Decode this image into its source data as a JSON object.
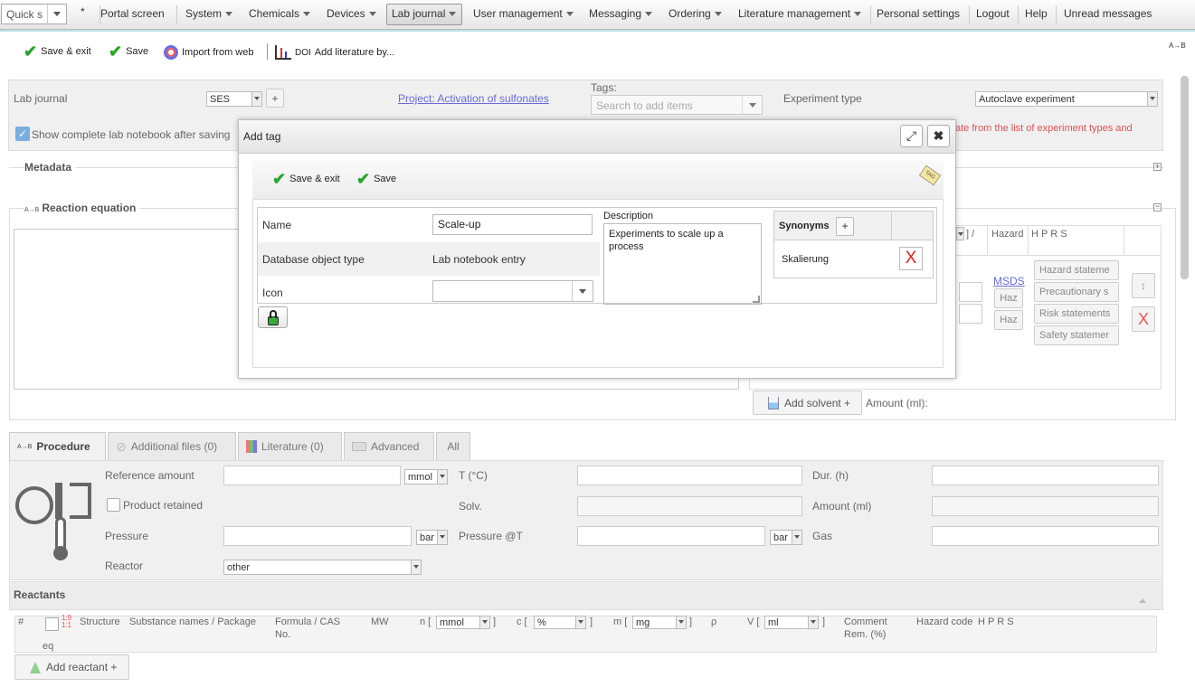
{
  "menubar": {
    "quick_search": "Quick s",
    "star": "*",
    "items": [
      "Portal screen",
      "System",
      "Chemicals",
      "Devices",
      "Lab journal",
      "User management",
      "Messaging",
      "Ordering",
      "Literature management",
      "Personal settings",
      "Logout",
      "Help",
      "Unread messages"
    ]
  },
  "toolbar": {
    "save_exit": "Save & exit",
    "save": "Save",
    "import_web": "Import from web",
    "doi": "DOI",
    "add_literature": "Add literature by...",
    "right_icon": "A→B"
  },
  "form": {
    "lab_journal_label": "Lab journal",
    "lab_journal_value": "SES",
    "plus": "+",
    "project_link": "Project: Activation of sulfonates",
    "tags_label": "Tags:",
    "tags_placeholder": "Search to add items",
    "experiment_type_label": "Experiment type",
    "experiment_type_value": "Autoclave experiment",
    "show_notebook": "Show complete lab notebook after saving",
    "warning_text": "ate from the list of experiment types and",
    "metadata_legend": "Metadata",
    "reaction_legend": "Reaction equation",
    "reaction_prefix": "A→B",
    "hazard_col": "Hazard",
    "hprs_col": "H P R S",
    "bracket_col": "] /",
    "msds": "MSDS",
    "haz": "Haz",
    "hazard_statements": "Hazard stateme",
    "precautionary": "Precautionary s",
    "risk_statements": "Risk statements",
    "safety_statements": "Safety statemer",
    "add_solvent": "Add solvent +",
    "amount_ml_label": "Amount (ml):"
  },
  "tabs": [
    {
      "label": "Procedure",
      "icon": "reaction-icon",
      "prefix": "A→B"
    },
    {
      "label": "Additional files (0)",
      "icon": "paperclip-icon"
    },
    {
      "label": "Literature (0)",
      "icon": "books-icon"
    },
    {
      "label": "Advanced",
      "icon": "advanced-icon"
    },
    {
      "label": "All"
    }
  ],
  "procedure": {
    "reference_amount": "Reference amount",
    "ref_unit": "mmol",
    "temp": "T (°C)",
    "duration": "Dur. (h)",
    "product_retained": "Product retained",
    "solv": "Solv.",
    "amount_ml": "Amount (ml)",
    "pressure": "Pressure",
    "pressure_unit": "bar",
    "pressure_t": "Pressure @T",
    "pressure_t_unit": "bar",
    "gas": "Gas",
    "reactor": "Reactor",
    "reactor_value": "other"
  },
  "reactants": {
    "title": "Reactants",
    "cols": {
      "num": "#",
      "eq": "eq",
      "structure": "Structure",
      "substance": "Substance names / Package",
      "formula": "Formula / CAS No.",
      "mw": "MW",
      "n": "n [",
      "n_unit": "mmol",
      "c": "c [",
      "c_unit": "%",
      "m": "m [",
      "m_unit": "mg",
      "rho": "ρ",
      "v": "V [",
      "v_unit": "ml",
      "close": "]",
      "comment": "Comment Rem. (%)",
      "hazard_code": "Hazard code",
      "hprs": "H P R S"
    },
    "add_reactant": "Add reactant +"
  },
  "dialog": {
    "title": "Add tag",
    "save_exit": "Save & exit",
    "save": "Save",
    "tag_icon": "TAG",
    "name_label": "Name",
    "name_value": "Scale-up",
    "dbtype_label": "Database object type",
    "dbtype_value": "Lab notebook entry",
    "icon_label": "Icon",
    "description_label": "Description",
    "description_value": "Experiments to scale up a process",
    "synonyms_label": "Synonyms",
    "synonyms_add": "+",
    "synonym_1": "Skalierung",
    "delete_glyph": "X"
  },
  "colors": {
    "accent_check": "#2ba52b",
    "link": "#5a5ad2",
    "warning": "#e05050",
    "delete_red": "#e02020"
  }
}
